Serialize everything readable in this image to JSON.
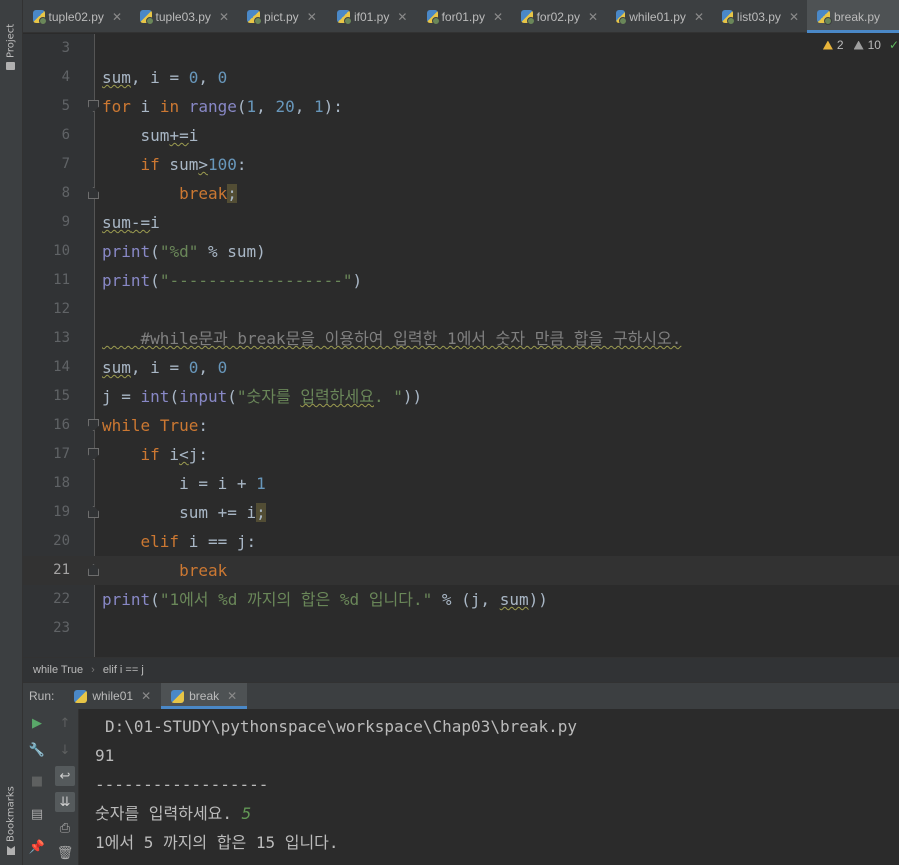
{
  "left_strip": {
    "project_label": "Project",
    "bookmarks_label": "Bookmarks"
  },
  "tabs": [
    {
      "label": "tuple02.py",
      "active": false
    },
    {
      "label": "tuple03.py",
      "active": false
    },
    {
      "label": "pict.py",
      "active": false
    },
    {
      "label": "if01.py",
      "active": false
    },
    {
      "label": "for01.py",
      "active": false
    },
    {
      "label": "for02.py",
      "active": false
    },
    {
      "label": "while01.py",
      "active": false
    },
    {
      "label": "list03.py",
      "active": false
    },
    {
      "label": "break.py",
      "active": true
    }
  ],
  "inspections": {
    "warnings": "2",
    "weak_warnings": "10",
    "check": "✓"
  },
  "editor": {
    "current_line": 21,
    "lines": [
      {
        "n": "3",
        "code": ""
      },
      {
        "n": "4",
        "code": "sum, i = 0, 0"
      },
      {
        "n": "5",
        "code": "for i in range(1, 20, 1):"
      },
      {
        "n": "6",
        "code": "    sum+=i"
      },
      {
        "n": "7",
        "code": "    if sum>100:"
      },
      {
        "n": "8",
        "code": "        break;"
      },
      {
        "n": "9",
        "code": "sum-=i"
      },
      {
        "n": "10",
        "code": "print(\"%d\" % sum)"
      },
      {
        "n": "11",
        "code": "print(\"------------------\")"
      },
      {
        "n": "12",
        "code": ""
      },
      {
        "n": "13",
        "code": "    #while문과 break문을 이용하여 입력한 1에서 숫자 만큼 합을 구하시오."
      },
      {
        "n": "14",
        "code": "sum, i = 0, 0"
      },
      {
        "n": "15",
        "code": "j = int(input(\"숫자를 입력하세요. \"))"
      },
      {
        "n": "16",
        "code": "while True:"
      },
      {
        "n": "17",
        "code": "    if i<j:"
      },
      {
        "n": "18",
        "code": "        i = i + 1"
      },
      {
        "n": "19",
        "code": "        sum += i;"
      },
      {
        "n": "20",
        "code": "    elif i == j:"
      },
      {
        "n": "21",
        "code": "        break"
      },
      {
        "n": "22",
        "code": "print(\"1에서 %d 까지의 합은 %d 입니다.\" % (j, sum))"
      },
      {
        "n": "23",
        "code": ""
      }
    ]
  },
  "breadcrumb": {
    "items": [
      "while True",
      "elif i == j"
    ],
    "separator": "›"
  },
  "run": {
    "label": "Run:",
    "tabs": [
      {
        "label": "while01",
        "active": false
      },
      {
        "label": "break",
        "active": true
      }
    ]
  },
  "console": {
    "path": "D:\\01-STUDY\\pythonspace\\workspace\\Chap03\\break.py",
    "output1": "91",
    "dashes": "------------------",
    "prompt": "숫자를 입력하세요. ",
    "user_input": "5",
    "result": "1에서 5 까지의 합은 15 입니다."
  },
  "colors": {
    "keyword": "#cc7832",
    "number": "#6897bb",
    "string": "#6a8759",
    "comment": "#808080",
    "builtin": "#8888c6",
    "default": "#a9b7c6",
    "accent": "#4a88c7"
  }
}
